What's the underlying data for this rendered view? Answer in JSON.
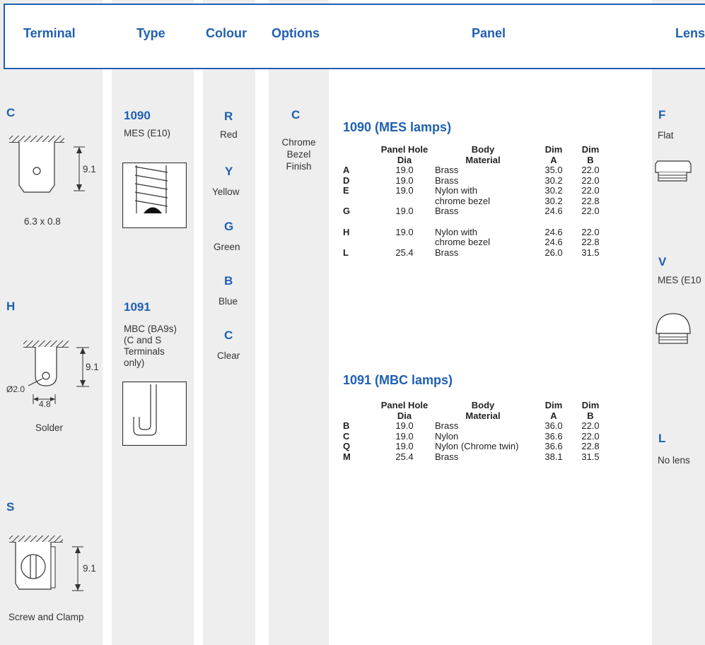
{
  "headers": {
    "terminal": "Terminal",
    "type": "Type",
    "colour": "Colour",
    "options": "Options",
    "panel": "Panel",
    "lens": "Lens"
  },
  "terminal": {
    "c": {
      "code": "C",
      "dim": "9.1",
      "caption": "6.3 x 0.8"
    },
    "h": {
      "code": "H",
      "dim": "9.1",
      "dia": "Ø2.0",
      "width": "4.8",
      "caption": "Solder"
    },
    "s": {
      "code": "S",
      "dim": "9.1",
      "caption": "Screw and Clamp"
    }
  },
  "type": {
    "t1090": {
      "code": "1090",
      "desc": "MES (E10)"
    },
    "t1091": {
      "code": "1091",
      "desc_lines": [
        "MBC (BA9s)",
        "(C and S",
        "Terminals",
        "only)"
      ]
    }
  },
  "colours": [
    {
      "code": "R",
      "name": "Red"
    },
    {
      "code": "Y",
      "name": "Yellow"
    },
    {
      "code": "G",
      "name": "Green"
    },
    {
      "code": "B",
      "name": "Blue"
    },
    {
      "code": "C",
      "name": "Clear"
    }
  ],
  "options": {
    "code": "C",
    "lines": [
      "Chrome",
      "Bezel",
      "Finish"
    ]
  },
  "panel": {
    "headers": {
      "hole1": "Panel Hole",
      "hole2": "Dia",
      "body1": "Body",
      "body2": "Material",
      "dima1": "Dim",
      "dima2": "A",
      "dimb1": "Dim",
      "dimb2": "B"
    },
    "mes": {
      "title": "1090 (MES lamps)",
      "rows": [
        {
          "letter": "A",
          "dia": "19.0",
          "material": "Brass",
          "a": "35.0",
          "b": "22.0"
        },
        {
          "letter": "D",
          "dia": "19.0",
          "material": "Brass",
          "a": "30.2",
          "b": "22.0"
        },
        {
          "letter": "E",
          "dia": "19.0",
          "material": "Nylon with",
          "a": "30.2",
          "b": "22.0"
        },
        {
          "letter": "",
          "dia": "",
          "material": "chrome bezel",
          "a": "30.2",
          "b": "22.8"
        },
        {
          "letter": "G",
          "dia": "19.0",
          "material": "Brass",
          "a": "24.6",
          "b": "22.0"
        },
        {
          "letter": "H",
          "dia": "19.0",
          "material": "Nylon with",
          "a": "24.6",
          "b": "22.0"
        },
        {
          "letter": "",
          "dia": "",
          "material": "chrome bezel",
          "a": "24.6",
          "b": "22.8"
        },
        {
          "letter": "L",
          "dia": "25.4",
          "material": "Brass",
          "a": "26.0",
          "b": "31.5"
        }
      ]
    },
    "mbc": {
      "title": "1091 (MBC lamps)",
      "rows": [
        {
          "letter": "B",
          "dia": "19.0",
          "material": "Brass",
          "a": "36.0",
          "b": "22.0"
        },
        {
          "letter": "C",
          "dia": "19.0",
          "material": "Nylon",
          "a": "36.6",
          "b": "22.0"
        },
        {
          "letter": "Q",
          "dia": "19.0",
          "material": "Nylon (Chrome twin)",
          "a": "36.6",
          "b": "22.8"
        },
        {
          "letter": "M",
          "dia": "25.4",
          "material": "Brass",
          "a": "38.1",
          "b": "31.5"
        }
      ]
    }
  },
  "lens": [
    {
      "code": "F",
      "name": "Flat"
    },
    {
      "code": "V",
      "name": "MES (E10"
    },
    {
      "code": "L",
      "name": "No lens"
    }
  ]
}
